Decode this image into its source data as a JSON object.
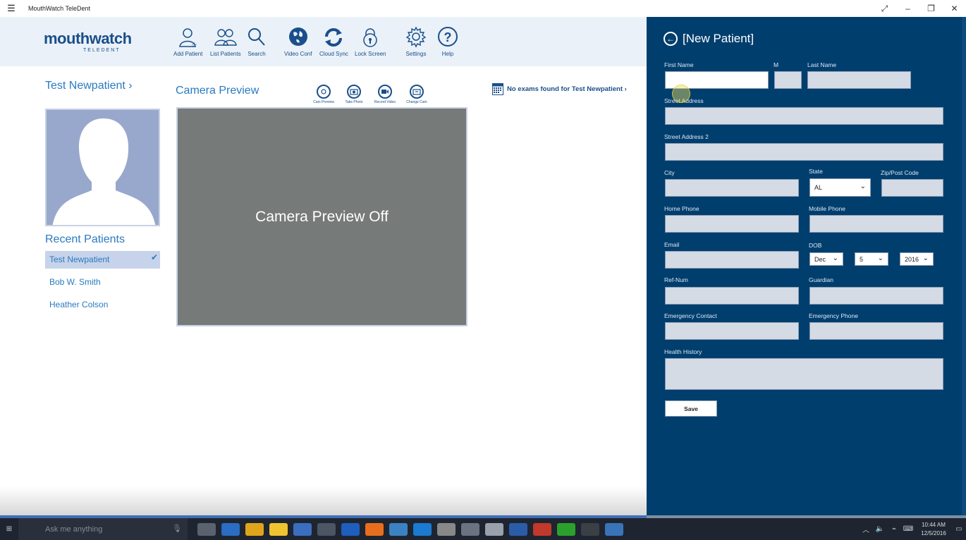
{
  "window": {
    "title": "MouthWatch TeleDent",
    "menu_icon": "hamburger-icon",
    "controls": [
      "expand-icon",
      "minimize-icon",
      "restore-icon",
      "close-icon"
    ]
  },
  "logo": {
    "brand": "mouthwatch",
    "sub": "TELEDENT"
  },
  "toolbar": {
    "add_patient": "Add Patient",
    "list_patients": "List Patients",
    "search": "Search",
    "video_conf": "Video Conf",
    "cloud_sync": "Cloud Sync",
    "lock_screen": "Lock Screen",
    "settings": "Settings",
    "help": "Help"
  },
  "patient": {
    "name": "Test  Newpatient  ›"
  },
  "recent": {
    "title": "Recent Patients",
    "items": [
      "Test  Newpatient",
      "Bob W. Smith",
      "Heather  Colson"
    ]
  },
  "camera": {
    "title": "Camera Preview",
    "status": "Camera Preview Off",
    "buttons": [
      "Cam Preview",
      "Take Photo",
      "Record Video",
      "Change Cam"
    ]
  },
  "exams": {
    "text": "No exams found for Test  Newpatient  ›"
  },
  "form": {
    "header": "[New Patient]",
    "labels": {
      "first_name": "First Name",
      "middle": "M",
      "last_name": "Last Name",
      "street": "Street Address",
      "street2": "Street Address 2",
      "city": "City",
      "state": "State",
      "zip": "Zip/Post Code",
      "home_phone": "Home Phone",
      "mobile_phone": "Mobile Phone",
      "email": "Email",
      "dob": "DOB",
      "ref_num": "Ref-Num",
      "guardian": "Guardian",
      "emergency_contact": "Emergency Contact",
      "emergency_phone": "Emergency Phone",
      "health_history": "Health History"
    },
    "state_value": "AL",
    "dob_month": "Dec",
    "dob_day": "5",
    "dob_year": "2016",
    "save": "Save"
  },
  "taskbar": {
    "search_placeholder": "Ask me anything",
    "time": "10:44 AM",
    "date": "12/5/2016",
    "app_colors": [
      "#5a6270",
      "#2b6cc4",
      "#e0a41b",
      "#f0c431",
      "#3a6fbf",
      "#4b5563",
      "#1e5ebd",
      "#e86e1d",
      "#3b82c4",
      "#1a7bd1",
      "#888888",
      "#6b7280",
      "#9aa1ab",
      "#2b5ca8",
      "#c0392b",
      "#2ca02c",
      "#3b3f46",
      "#3a74b8"
    ]
  }
}
